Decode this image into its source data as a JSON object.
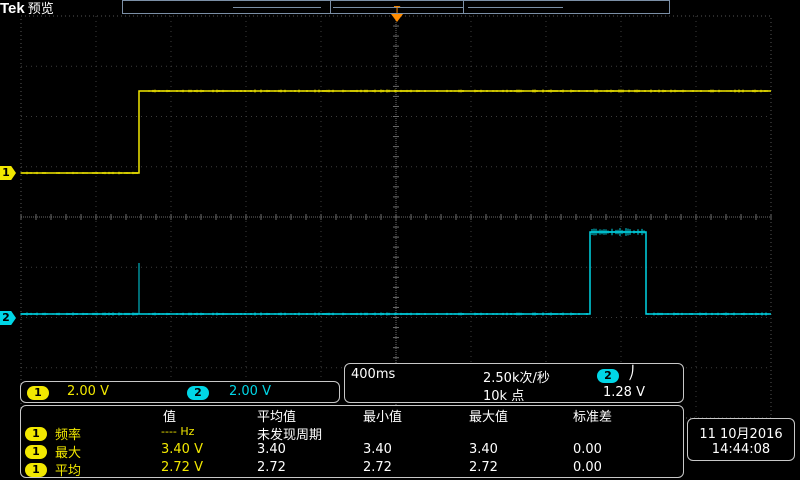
{
  "header": {
    "brand": "Tek",
    "mode": "预览"
  },
  "channels": {
    "ch1": {
      "label": "1",
      "color": "#f2e800",
      "scale": "2.00 V"
    },
    "ch2": {
      "label": "2",
      "color": "#00d6e6",
      "scale": "2.00 V"
    }
  },
  "timebase": {
    "time_div": "400ms",
    "sample_rate": "2.50k次/秒",
    "record_length": "10k 点",
    "trigger_source": "2",
    "trigger_slope": "⎠",
    "trigger_level": "1.28 V"
  },
  "measurements": {
    "headers": [
      "值",
      "平均值",
      "最小值",
      "最大值",
      "标准差"
    ],
    "rows": [
      {
        "channel": "1",
        "name": "频率",
        "value": "---- Hz",
        "mean": "未发现周期",
        "min": "",
        "max": "",
        "std": ""
      },
      {
        "channel": "1",
        "name": "最大",
        "value": "3.40 V",
        "mean": "3.40",
        "min": "3.40",
        "max": "3.40",
        "std": "0.00"
      },
      {
        "channel": "1",
        "name": "平均",
        "value": "2.72 V",
        "mean": "2.72",
        "min": "2.72",
        "max": "2.72",
        "std": "0.00"
      }
    ]
  },
  "clock": {
    "date": "11 10月2016",
    "time": "14:44:08"
  }
}
